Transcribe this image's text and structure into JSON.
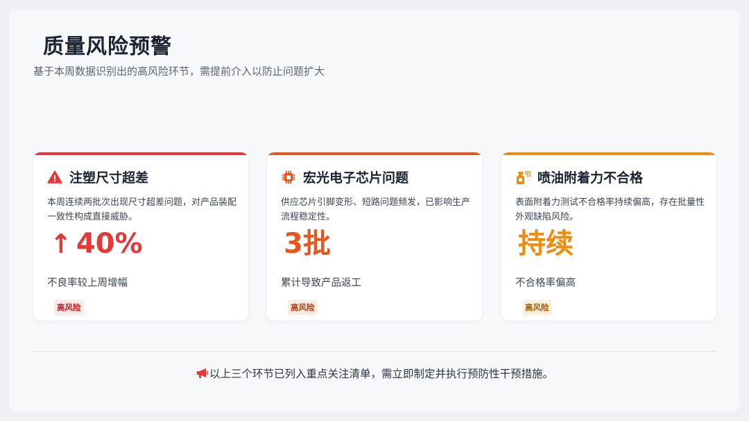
{
  "page": {
    "title": "质量风险预警",
    "subtitle": "基于本周数据识别出的高风险环节，需提前介入以防止问题扩大"
  },
  "colors": {
    "red": "#e5383b",
    "orange_red": "#e8561c",
    "orange": "#f08c0a"
  },
  "cards": [
    {
      "icon": "warning-triangle-icon",
      "title": "注塑尺寸超差",
      "description": "本周连续两批次出现尺寸超差问题，对产品装配一致性构成直接威胁。",
      "metric_arrow": "↑",
      "metric": "40%",
      "metric_label": "不良率较上周增幅",
      "badge": "高风险"
    },
    {
      "icon": "chip-icon",
      "title": "宏光电子芯片问题",
      "description": "供应芯片引脚变形、短路问题频发，已影响生产流程稳定性。",
      "metric": "3批",
      "metric_label": "累计导致产品返工",
      "badge": "高风险"
    },
    {
      "icon": "spray-can-icon",
      "title": "喷油附着力不合格",
      "description": "表面附着力测试不合格率持续偏高，存在批量性外观缺陷风险。",
      "metric": "持续",
      "metric_label": "不合格率偏高",
      "badge": "高风险"
    }
  ],
  "footer": {
    "icon": "megaphone-icon",
    "text": "以上三个环节已列入重点关注清单，需立即制定并执行预防性干预措施。"
  }
}
